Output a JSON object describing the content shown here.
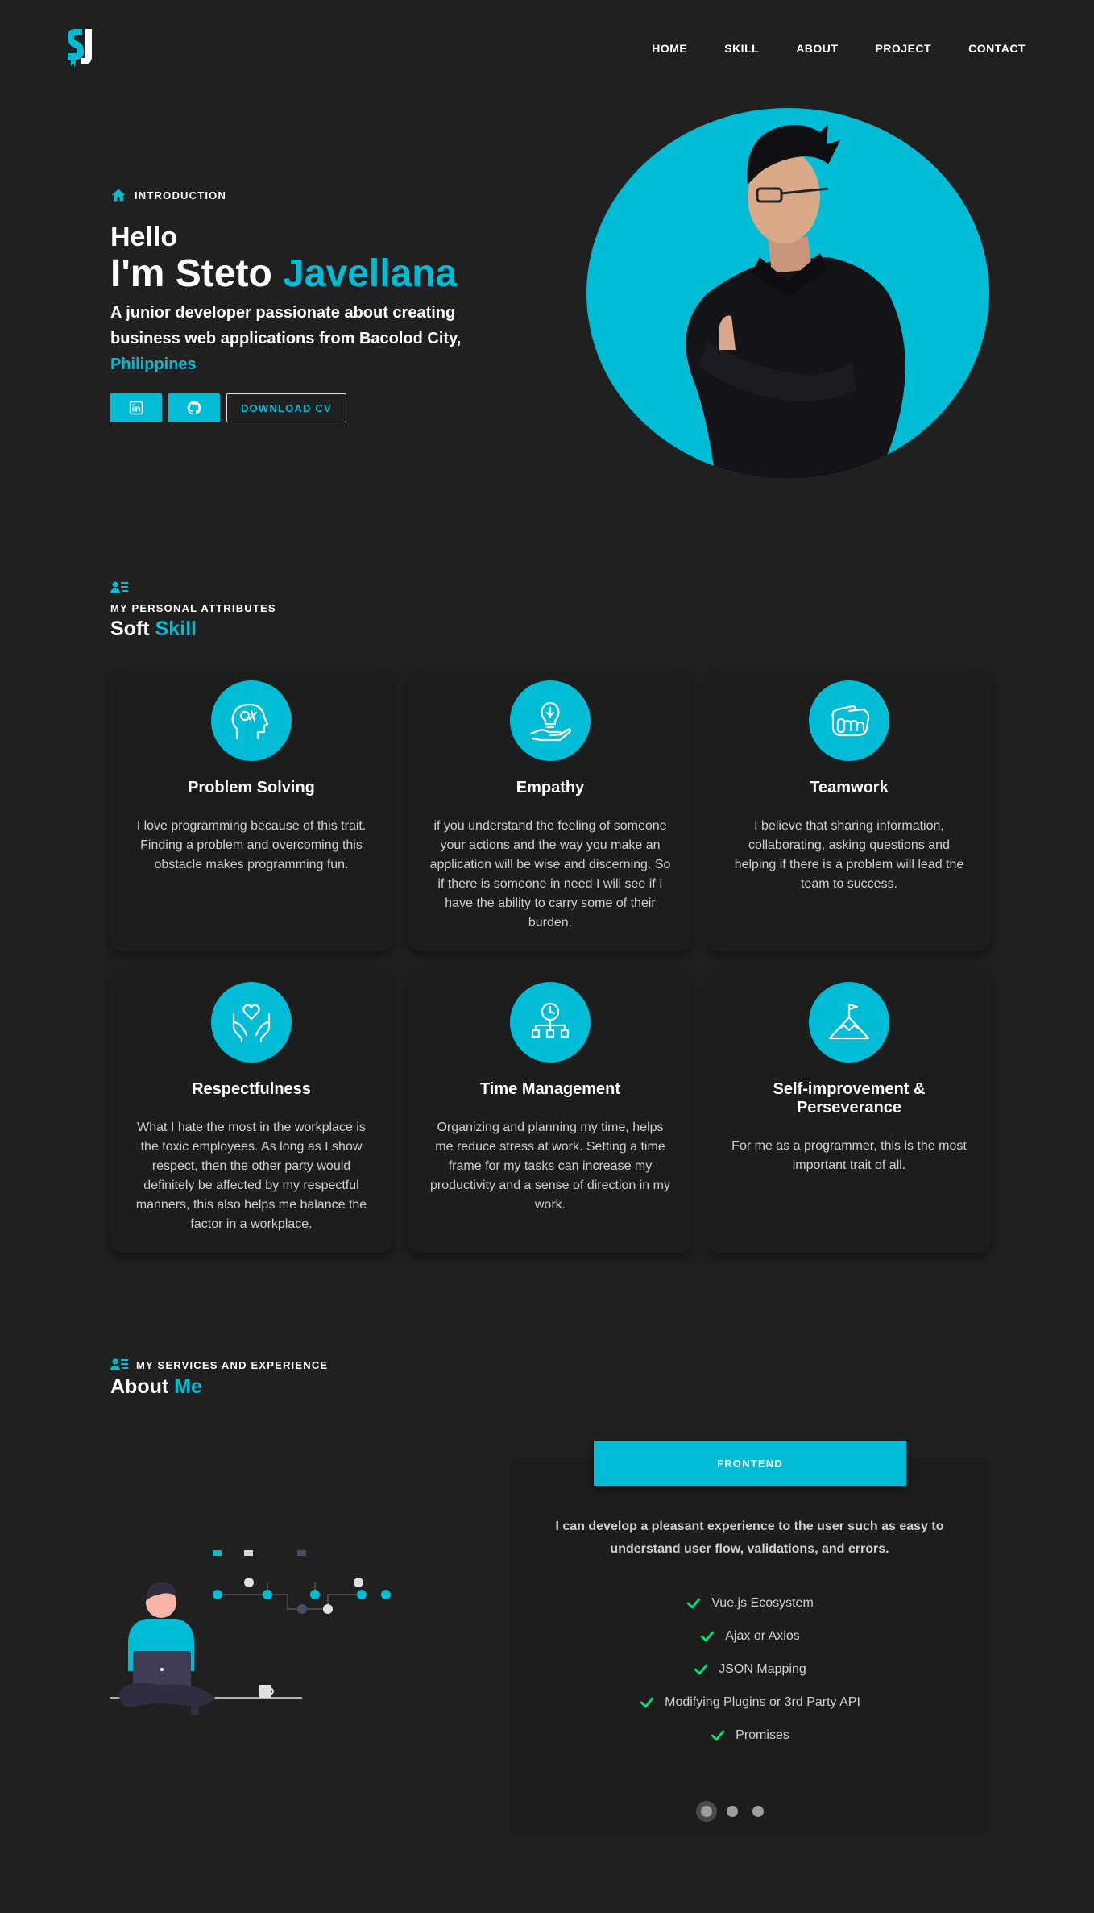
{
  "nav": {
    "logo_text": "SJ",
    "links": [
      "HOME",
      "SKILL",
      "ABOUT",
      "PROJECT",
      "CONTACT"
    ]
  },
  "hero": {
    "eyebrow": "INTRODUCTION",
    "hello": "Hello",
    "name_prefix": "I'm Steto ",
    "name_highlight": "Javellana",
    "tagline": "A junior developer passionate about creating business web applications from Bacolod City, ",
    "tagline_highlight": "Philippines",
    "download_label": "DOWNLOAD CV",
    "icons": [
      "linkedin-icon",
      "github-icon"
    ]
  },
  "skills": {
    "label": "MY PERSONAL ATTRIBUTES",
    "title_prefix": "Soft ",
    "title_highlight": "Skill",
    "cards": [
      {
        "icon": "brain-icon",
        "title": "Problem Solving",
        "text": "I love programming because of this trait. Finding a problem and overcoming this obstacle makes programming fun."
      },
      {
        "icon": "lightbulb-hand-icon",
        "title": "Empathy",
        "text": "if you understand the feeling of someone your actions and the way you make an application will be wise and discerning. So if there is someone in need I will see if I have the ability to carry some of their burden."
      },
      {
        "icon": "handshake-icon",
        "title": "Teamwork",
        "text": "I believe that sharing information, collaborating, asking questions and helping if there is a problem will lead the team to success."
      },
      {
        "icon": "hands-heart-icon",
        "title": "Respectfulness",
        "text": "What I hate the most in the workplace is the toxic employees. As long as I show respect, then the other party would definitely be affected by my respectful manners, this also helps me balance the factor in a workplace."
      },
      {
        "icon": "clock-hierarchy-icon",
        "title": "Time Management",
        "text": "Organizing and planning my time, helps me reduce stress at work. Setting a time frame for my tasks can increase my productivity and a sense of direction in my work."
      },
      {
        "icon": "mountain-flag-icon",
        "title": "Self-improvement & Perseverance",
        "text": "For me as a programmer, this is the most important trait of all."
      }
    ]
  },
  "about": {
    "label": "MY SERVICES AND EXPERIENCE",
    "title_prefix": "About ",
    "title_highlight": "Me",
    "tab_label": "FRONTEND",
    "description": "I can develop a pleasant experience to the user such as easy to understand user flow, validations, and errors.",
    "items": [
      "Vue.js Ecosystem",
      "Ajax or Axios",
      "JSON Mapping",
      "Modifying Plugins or 3rd Party API",
      "Promises"
    ],
    "carousel_pages": 3,
    "carousel_active": 1
  },
  "colors": {
    "accent": "#00bcd4",
    "background": "#202020",
    "check": "#00e676"
  }
}
